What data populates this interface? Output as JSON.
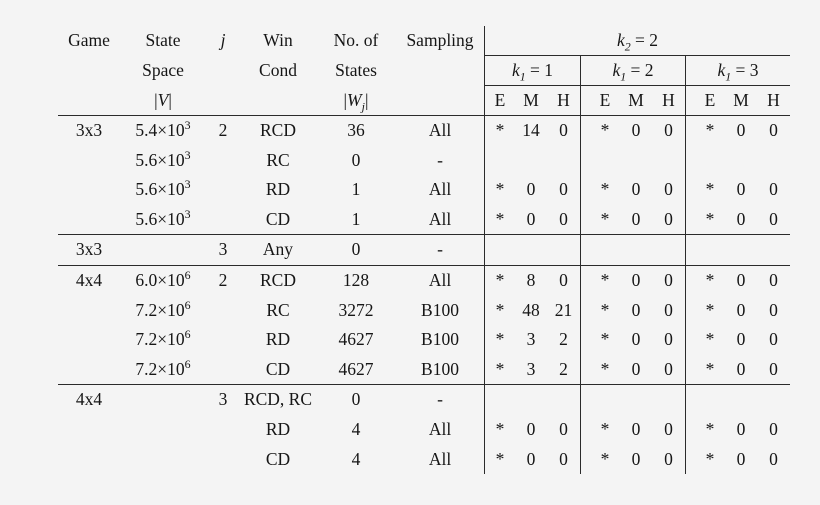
{
  "table": {
    "header": {
      "game": "Game",
      "state_space_l1": "State",
      "state_space_l2": "Space",
      "state_space_l3": "|V|",
      "j": "j",
      "win_l1": "Win",
      "win_l2": "Cond",
      "states_l1": "No. of",
      "states_l2": "States",
      "states_l3": "|W_j|",
      "sampling": "Sampling",
      "k2_group": "k2 = 2",
      "k1_groups": [
        "k1 = 1",
        "k1 = 2",
        "k1 = 3"
      ],
      "sub_cols": [
        "E",
        "M",
        "H"
      ]
    },
    "blocks": [
      {
        "rows": [
          {
            "game": "3x3",
            "space_mantissa": "5.4",
            "space_exp": "3",
            "j": "2",
            "win": "RCD",
            "states": "36",
            "sampling": "All",
            "k1_1": [
              "*",
              "14",
              "0"
            ],
            "k1_2": [
              "*",
              "0",
              "0"
            ],
            "k1_3": [
              "*",
              "0",
              "0"
            ]
          },
          {
            "game": "",
            "space_mantissa": "5.6",
            "space_exp": "3",
            "j": "",
            "win": "RC",
            "states": "0",
            "sampling": "-",
            "k1_1": [
              "",
              "",
              ""
            ],
            "k1_2": [
              "",
              "",
              ""
            ],
            "k1_3": [
              "",
              "",
              ""
            ]
          },
          {
            "game": "",
            "space_mantissa": "5.6",
            "space_exp": "3",
            "j": "",
            "win": "RD",
            "states": "1",
            "sampling": "All",
            "k1_1": [
              "*",
              "0",
              "0"
            ],
            "k1_2": [
              "*",
              "0",
              "0"
            ],
            "k1_3": [
              "*",
              "0",
              "0"
            ]
          },
          {
            "game": "",
            "space_mantissa": "5.6",
            "space_exp": "3",
            "j": "",
            "win": "CD",
            "states": "1",
            "sampling": "All",
            "k1_1": [
              "*",
              "0",
              "0"
            ],
            "k1_2": [
              "*",
              "0",
              "0"
            ],
            "k1_3": [
              "*",
              "0",
              "0"
            ]
          }
        ]
      },
      {
        "rows": [
          {
            "game": "3x3",
            "space_mantissa": "",
            "space_exp": "",
            "j": "3",
            "win": "Any",
            "states": "0",
            "sampling": "-",
            "k1_1": [
              "",
              "",
              ""
            ],
            "k1_2": [
              "",
              "",
              ""
            ],
            "k1_3": [
              "",
              "",
              ""
            ]
          }
        ]
      },
      {
        "rows": [
          {
            "game": "4x4",
            "space_mantissa": "6.0",
            "space_exp": "6",
            "j": "2",
            "win": "RCD",
            "states": "128",
            "sampling": "All",
            "k1_1": [
              "*",
              "8",
              "0"
            ],
            "k1_2": [
              "*",
              "0",
              "0"
            ],
            "k1_3": [
              "*",
              "0",
              "0"
            ]
          },
          {
            "game": "",
            "space_mantissa": "7.2",
            "space_exp": "6",
            "j": "",
            "win": "RC",
            "states": "3272",
            "sampling": "B100",
            "k1_1": [
              "*",
              "48",
              "21"
            ],
            "k1_2": [
              "*",
              "0",
              "0"
            ],
            "k1_3": [
              "*",
              "0",
              "0"
            ]
          },
          {
            "game": "",
            "space_mantissa": "7.2",
            "space_exp": "6",
            "j": "",
            "win": "RD",
            "states": "4627",
            "sampling": "B100",
            "k1_1": [
              "*",
              "3",
              "2"
            ],
            "k1_2": [
              "*",
              "0",
              "0"
            ],
            "k1_3": [
              "*",
              "0",
              "0"
            ]
          },
          {
            "game": "",
            "space_mantissa": "7.2",
            "space_exp": "6",
            "j": "",
            "win": "CD",
            "states": "4627",
            "sampling": "B100",
            "k1_1": [
              "*",
              "3",
              "2"
            ],
            "k1_2": [
              "*",
              "0",
              "0"
            ],
            "k1_3": [
              "*",
              "0",
              "0"
            ]
          }
        ]
      },
      {
        "rows": [
          {
            "game": "4x4",
            "space_mantissa": "",
            "space_exp": "",
            "j": "3",
            "win": "RCD, RC",
            "states": "0",
            "sampling": "-",
            "k1_1": [
              "",
              "",
              ""
            ],
            "k1_2": [
              "",
              "",
              ""
            ],
            "k1_3": [
              "",
              "",
              ""
            ]
          },
          {
            "game": "",
            "space_mantissa": "",
            "space_exp": "",
            "j": "",
            "win": "RD",
            "states": "4",
            "sampling": "All",
            "k1_1": [
              "*",
              "0",
              "0"
            ],
            "k1_2": [
              "*",
              "0",
              "0"
            ],
            "k1_3": [
              "*",
              "0",
              "0"
            ]
          },
          {
            "game": "",
            "space_mantissa": "",
            "space_exp": "",
            "j": "",
            "win": "CD",
            "states": "4",
            "sampling": "All",
            "k1_1": [
              "*",
              "0",
              "0"
            ],
            "k1_2": [
              "*",
              "0",
              "0"
            ],
            "k1_3": [
              "*",
              "0",
              "0"
            ]
          }
        ]
      }
    ]
  }
}
